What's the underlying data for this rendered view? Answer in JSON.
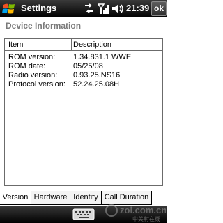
{
  "titlebar": {
    "app_title": "Settings",
    "clock": "21:39",
    "ok_label": "ok",
    "icons": [
      "windows-start-icon",
      "data-connection-icon",
      "signal-strength-icon",
      "volume-icon"
    ]
  },
  "section": {
    "title": "Device Information"
  },
  "listview": {
    "columns": [
      "Item",
      "Description"
    ],
    "rows": [
      {
        "item": "ROM version:",
        "description": "1.34.831.1 WWE"
      },
      {
        "item": "ROM date:",
        "description": "05/25/08"
      },
      {
        "item": "Radio version:",
        "description": "0.93.25.NS16"
      },
      {
        "item": "Protocol version:",
        "description": "52.24.25.08H"
      }
    ]
  },
  "tabs": [
    {
      "label": "Version",
      "active": true
    },
    {
      "label": "Hardware",
      "active": false
    },
    {
      "label": "Identity",
      "active": false
    },
    {
      "label": "Call Duration",
      "active": false
    }
  ],
  "watermark": {
    "text": "zol.com.cn",
    "subtext": "中关村在线"
  },
  "colors": {
    "bar": "#1a1a1a",
    "header_text": "#7a7a7a",
    "border": "#6b6b6b"
  }
}
